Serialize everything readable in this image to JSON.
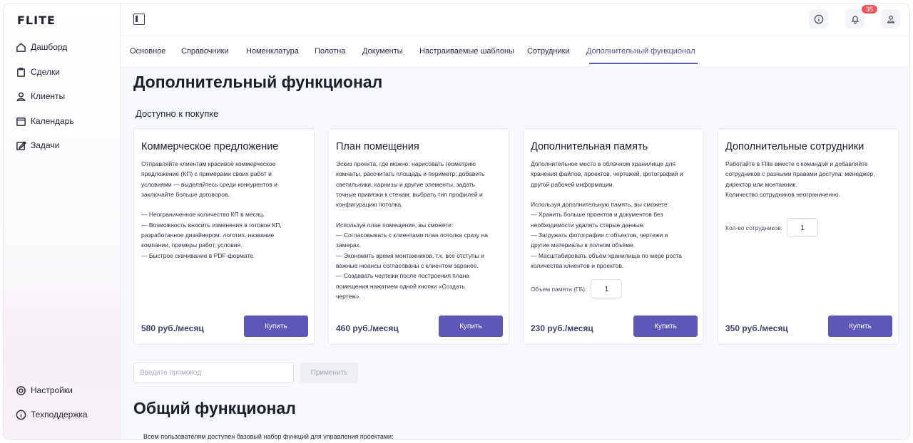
{
  "app": {
    "logo": "FLITE"
  },
  "sidebar": {
    "items": [
      {
        "label": "Дашборд",
        "icon": "home-icon"
      },
      {
        "label": "Сделки",
        "icon": "clipboard-icon"
      },
      {
        "label": "Клиенты",
        "icon": "user-icon"
      },
      {
        "label": "Календарь",
        "icon": "calendar-icon"
      },
      {
        "label": "Задачи",
        "icon": "edit-icon"
      }
    ],
    "bottom_items": [
      {
        "label": "Настройки",
        "icon": "gear-icon"
      },
      {
        "label": "Техподдержка",
        "icon": "info-icon"
      }
    ]
  },
  "topbar": {
    "notifications_count": "35",
    "icons": [
      "panel-toggle-icon",
      "info-icon",
      "bell-icon",
      "user-icon"
    ]
  },
  "tabs": [
    "Основное",
    "Справочники",
    "Номенклатура",
    "Полотна",
    "Документы",
    "Настраиваемые шаблоны",
    "Сотрудники",
    "Дополнительный функционал"
  ],
  "active_tab": "Дополнительный функционал",
  "main": {
    "title": "Дополнительный функционал",
    "subtitle": "Доступно к покупке",
    "cards": [
      {
        "title": "Коммерческое предложение",
        "description": "Отправляйте клиентам красивое коммерческое\nпредложение (КП) с примерами своих работ и\nусловиями — выделяйтесь среди конкурентов и\nзаключайте больше договоров.\n\n— Неограниченное количество КП в месяц.\n— Возможность вносить изменения в готовое КП,\nразработанное дизайнером: логотип, название\nкомпании, примеры работ, условия.\n— Быстрое скачивание в PDF-формате.",
        "price": "580 руб./месяц",
        "button": "Купить"
      },
      {
        "title": "План помещения",
        "description": "Эскиз проекта, где можно: нарисовать геометрию\nкомнаты, рассчитать площадь и периметр; добавить\nсветильники, карнизы и другие элементы; задать\nточные привязки к стенам; выбрать тип профилей и\nконфигурацию потолка.\n\nИспользуя план помещения, вы сможете:\n— Согласовывать с клиентами план потолка сразу на\nзамерах.\n— Экономить время монтажников, т.к. все отступы и\nважные нюансы согласованы с клиентом заранее.\n— Создавать чертежи после построения плана\nпомещения нажатием одной кнопки «Создать\nчертеж».",
        "price": "460 руб./месяц",
        "button": "Купить"
      },
      {
        "title": "Дополнительная память",
        "description": "Дополнительное место в облачном хранилище для\nхранения файлов, проектов, чертежей, фотографий и\nдругой рабочей информации.\n\nИспользуя дополнительную память, вы сможете:\n— Хранить больше проектов и документов без\nнеобходимости удалять старые данные.\n— Загружать фотографии с объектов, чертежи и\nдругие материалы в полном объёме.\n— Масштабировать объём хранилища по мере роста\nколичества клиентов и проектов.",
        "quantity_label": "Объем памяти (ГБ):",
        "quantity_value": "1",
        "price": "230 руб./месяц",
        "button": "Купить"
      },
      {
        "title": "Дополнительные сотрудники",
        "description": "Работайте в Flite вместе с командой и добавляйте\nсотрудников с разными правами доступа: менеджер,\nдиректор или монтажник.\nКоличество сотрудников неограниченно.",
        "quantity_label": "Кол-во сотрудников:",
        "quantity_value": "1",
        "price": "350 руб./месяц",
        "button": "Купить"
      }
    ],
    "promo": {
      "placeholder": "Введите промокод",
      "apply_label": "Применить"
    },
    "general": {
      "title": "Общий функционал",
      "description": "Всем пользователям доступен базовый набор функций для управления проектами:"
    }
  },
  "colors": {
    "accent": "#5d58b8",
    "badge": "#e9565c",
    "price": "#3f4466"
  }
}
